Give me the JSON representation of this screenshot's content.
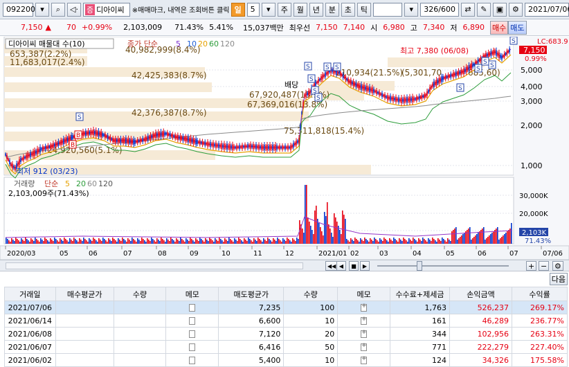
{
  "toolbar": {
    "code": "092200",
    "badge": "증",
    "name": "디아이씨",
    "hint": "※매매마크, 내역은 조회버튼 클릭",
    "period_label": "일",
    "period_value": "5",
    "periods": [
      "주",
      "월",
      "년",
      "분",
      "초",
      "틱"
    ],
    "count": "326",
    "count_max": "/600",
    "date": "2021/07/06"
  },
  "quote": {
    "price": "7,150",
    "change_arrow": "▲",
    "change": "70",
    "change_pct": "+0.99%",
    "volume": "2,103,009",
    "vol_ratio": "71.43%",
    "turnover": "5.41%",
    "amount": "15,037백만",
    "best_label": "최우선",
    "best_ask": "7,150",
    "best_bid": "7,140",
    "open_label": "시",
    "open": "6,980",
    "high_label": "고",
    "high": "7,340",
    "low_label": "저",
    "low": "6,890",
    "buy_btn": "매수",
    "sell_btn": "매도"
  },
  "chart_header": {
    "title": "디아이씨 매물대 수(10)",
    "ma_label": "종가 단순",
    "ma_periods": [
      "5",
      "10",
      "20",
      "60",
      "120"
    ],
    "vol_title": "거래량",
    "vol_ma_label": "단순",
    "vol_ma_periods": [
      "5",
      "20",
      "60",
      "120"
    ],
    "vol_today": "2,103,009주(71.43%)",
    "axis_label": "LC:683.9",
    "price_tag": "7,150",
    "pct_tag": "0.99%",
    "vol_tag": "2,103K",
    "vol_pct_tag": "71.43%",
    "high_note": "최고 7,380 (06/08)",
    "low_note": "최저 912 (03/23)",
    "marker_s": "S",
    "marker_b": "B",
    "sell_mark": "배당"
  },
  "chart_data": {
    "type": "candlestick",
    "y_ticks": [
      "5,000",
      "4,000",
      "3,000",
      "2,000",
      "1,000"
    ],
    "vol_ticks": [
      "30,000K",
      "20,000K",
      "10,000K"
    ],
    "x_ticks": [
      "2020/03",
      "05",
      "06",
      "07",
      "08",
      "09",
      "10",
      "11",
      "12",
      "2021/01",
      "02",
      "03",
      "04",
      "05",
      "06",
      "07",
      "07/06"
    ],
    "volume_profile": [
      "653,387(2.2%)",
      "11,683,017(2.4%)",
      "40,982,999(8.4%)",
      "42,425,383(8.7%)",
      "67,920,487(13.9%)",
      "67,369,016(13.8%)",
      "42,376,387(8.7%)",
      "75,311,818(15.4%)",
      "24,920,560(5.1%)",
      "210,934(21.5%)",
      "(5,301,70",
      "685,60)"
    ]
  },
  "grid": {
    "next_button": "다음",
    "columns": [
      "거래일",
      "매수평균가",
      "수량",
      "메모",
      "매도평균가",
      "수량",
      "메모",
      "수수료+제세금",
      "손익금액",
      "수익률"
    ],
    "rows": [
      [
        "2021/07/06",
        "",
        "",
        "",
        "7,235",
        "100",
        "",
        "1,763",
        "526,237",
        "269.17%"
      ],
      [
        "2021/06/14",
        "",
        "",
        "",
        "6,600",
        "10",
        "",
        "161",
        "46,289",
        "236.77%"
      ],
      [
        "2021/06/08",
        "",
        "",
        "",
        "7,120",
        "20",
        "",
        "344",
        "102,956",
        "263.31%"
      ],
      [
        "2021/06/07",
        "",
        "",
        "",
        "6,416",
        "50",
        "",
        "771",
        "222,279",
        "227.40%"
      ],
      [
        "2021/06/02",
        "",
        "",
        "",
        "5,400",
        "10",
        "",
        "124",
        "34,326",
        "175.58%"
      ]
    ]
  },
  "colors": {
    "up": "#e60012",
    "down": "#0033cc",
    "accent": "#f39a2a"
  }
}
